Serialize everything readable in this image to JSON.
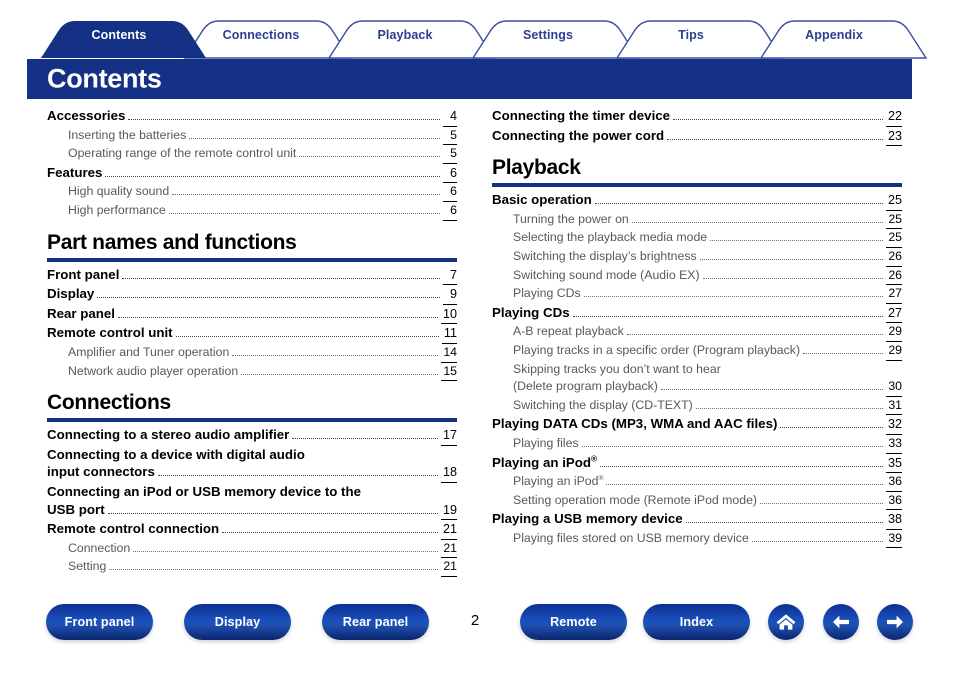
{
  "tabs": [
    {
      "label": "Contents",
      "active": true
    },
    {
      "label": "Connections",
      "active": false
    },
    {
      "label": "Playback",
      "active": false
    },
    {
      "label": "Settings",
      "active": false
    },
    {
      "label": "Tips",
      "active": false
    },
    {
      "label": "Appendix",
      "active": false
    }
  ],
  "header": {
    "title": "Contents"
  },
  "colors": {
    "brand_blue": "#143186",
    "tab_text": "#2b3f8f",
    "sub_text": "#58595b"
  },
  "left_column": [
    {
      "kind": "entry",
      "level": 1,
      "text": "Accessories",
      "page": "4"
    },
    {
      "kind": "entry",
      "level": 2,
      "text": "Inserting the batteries",
      "page": "5"
    },
    {
      "kind": "entry",
      "level": 2,
      "text": "Operating range of the remote control unit",
      "page": "5"
    },
    {
      "kind": "entry",
      "level": 1,
      "text": "Features",
      "page": "6"
    },
    {
      "kind": "entry",
      "level": 2,
      "text": "High quality sound",
      "page": "6"
    },
    {
      "kind": "entry",
      "level": 2,
      "text": "High performance",
      "page": "6"
    },
    {
      "kind": "section",
      "text": "Part names and functions"
    },
    {
      "kind": "entry",
      "level": 1,
      "text": "Front panel",
      "page": "7"
    },
    {
      "kind": "entry",
      "level": 1,
      "text": "Display",
      "page": "9"
    },
    {
      "kind": "entry",
      "level": 1,
      "text": "Rear panel",
      "page": "10"
    },
    {
      "kind": "entry",
      "level": 1,
      "text": "Remote control unit",
      "page": "11"
    },
    {
      "kind": "entry",
      "level": 2,
      "text": "Amplifier and Tuner operation",
      "page": "14"
    },
    {
      "kind": "entry",
      "level": 2,
      "text": "Network audio player operation",
      "page": "15"
    },
    {
      "kind": "section",
      "text": "Connections"
    },
    {
      "kind": "entry",
      "level": 1,
      "text": "Connecting to a stereo audio amplifier",
      "page": "17"
    },
    {
      "kind": "cont",
      "level": 1,
      "text": "Connecting to a device with digital audio"
    },
    {
      "kind": "entry",
      "level": 1,
      "text": "input connectors",
      "page": "18"
    },
    {
      "kind": "cont",
      "level": 1,
      "text": "Connecting an iPod or USB memory device to the"
    },
    {
      "kind": "entry",
      "level": 1,
      "text": "USB port",
      "page": "19"
    },
    {
      "kind": "entry",
      "level": 1,
      "text": "Remote control connection",
      "page": "21"
    },
    {
      "kind": "entry",
      "level": 2,
      "text": "Connection",
      "page": "21"
    },
    {
      "kind": "entry",
      "level": 2,
      "text": "Setting",
      "page": "21"
    }
  ],
  "right_column": [
    {
      "kind": "entry",
      "level": 1,
      "text": "Connecting the timer device",
      "page": "22"
    },
    {
      "kind": "entry",
      "level": 1,
      "text": "Connecting the power cord",
      "page": "23"
    },
    {
      "kind": "section",
      "text": "Playback"
    },
    {
      "kind": "entry",
      "level": 1,
      "text": "Basic operation",
      "page": "25"
    },
    {
      "kind": "entry",
      "level": 2,
      "text": "Turning the power on",
      "page": "25"
    },
    {
      "kind": "entry",
      "level": 2,
      "text": "Selecting the playback media mode",
      "page": "25"
    },
    {
      "kind": "entry",
      "level": 2,
      "text": "Switching the display’s brightness",
      "page": "26"
    },
    {
      "kind": "entry",
      "level": 2,
      "text": "Switching sound mode (Audio EX)",
      "page": "26"
    },
    {
      "kind": "entry",
      "level": 2,
      "text": "Playing CDs",
      "page": "27"
    },
    {
      "kind": "entry",
      "level": 1,
      "text": "Playing CDs",
      "page": "27"
    },
    {
      "kind": "entry",
      "level": 2,
      "text": "A-B repeat playback",
      "page": "29"
    },
    {
      "kind": "entry",
      "level": 2,
      "text": "Playing tracks in a specific order (Program playback)",
      "page": "29"
    },
    {
      "kind": "cont",
      "level": 2,
      "text": "Skipping tracks you don’t want to hear"
    },
    {
      "kind": "entry",
      "level": 2,
      "text": "(Delete program playback)",
      "page": "30"
    },
    {
      "kind": "entry",
      "level": 2,
      "text": "Switching the display (CD-TEXT)",
      "page": "31"
    },
    {
      "kind": "entry",
      "level": 1,
      "text": "Playing DATA CDs (MP3, WMA and AAC files)",
      "page": "32"
    },
    {
      "kind": "entry",
      "level": 2,
      "text": "Playing files",
      "page": "33"
    },
    {
      "kind": "entry",
      "level": 1,
      "text": "Playing an iPod",
      "sup": "®",
      "page": "35"
    },
    {
      "kind": "entry",
      "level": 2,
      "text": "Playing an iPod",
      "sup": "®",
      "page": "36"
    },
    {
      "kind": "entry",
      "level": 2,
      "text": "Setting operation mode (Remote iPod mode)",
      "page": "36"
    },
    {
      "kind": "entry",
      "level": 1,
      "text": "Playing a USB memory device",
      "page": "38"
    },
    {
      "kind": "entry",
      "level": 2,
      "text": "Playing files stored on USB memory device",
      "page": "39"
    }
  ],
  "footer": {
    "page_number": "2",
    "pills": [
      {
        "label": "Front panel",
        "name": "front-panel-button"
      },
      {
        "label": "Display",
        "name": "display-button"
      },
      {
        "label": "Rear panel",
        "name": "rear-panel-button"
      },
      {
        "label": "Remote",
        "name": "remote-button"
      },
      {
        "label": "Index",
        "name": "index-button"
      }
    ],
    "icons": [
      {
        "icon": "home-icon",
        "name": "home-button"
      },
      {
        "icon": "arrow-left-icon",
        "name": "previous-page-button"
      },
      {
        "icon": "arrow-right-icon",
        "name": "next-page-button"
      }
    ]
  }
}
